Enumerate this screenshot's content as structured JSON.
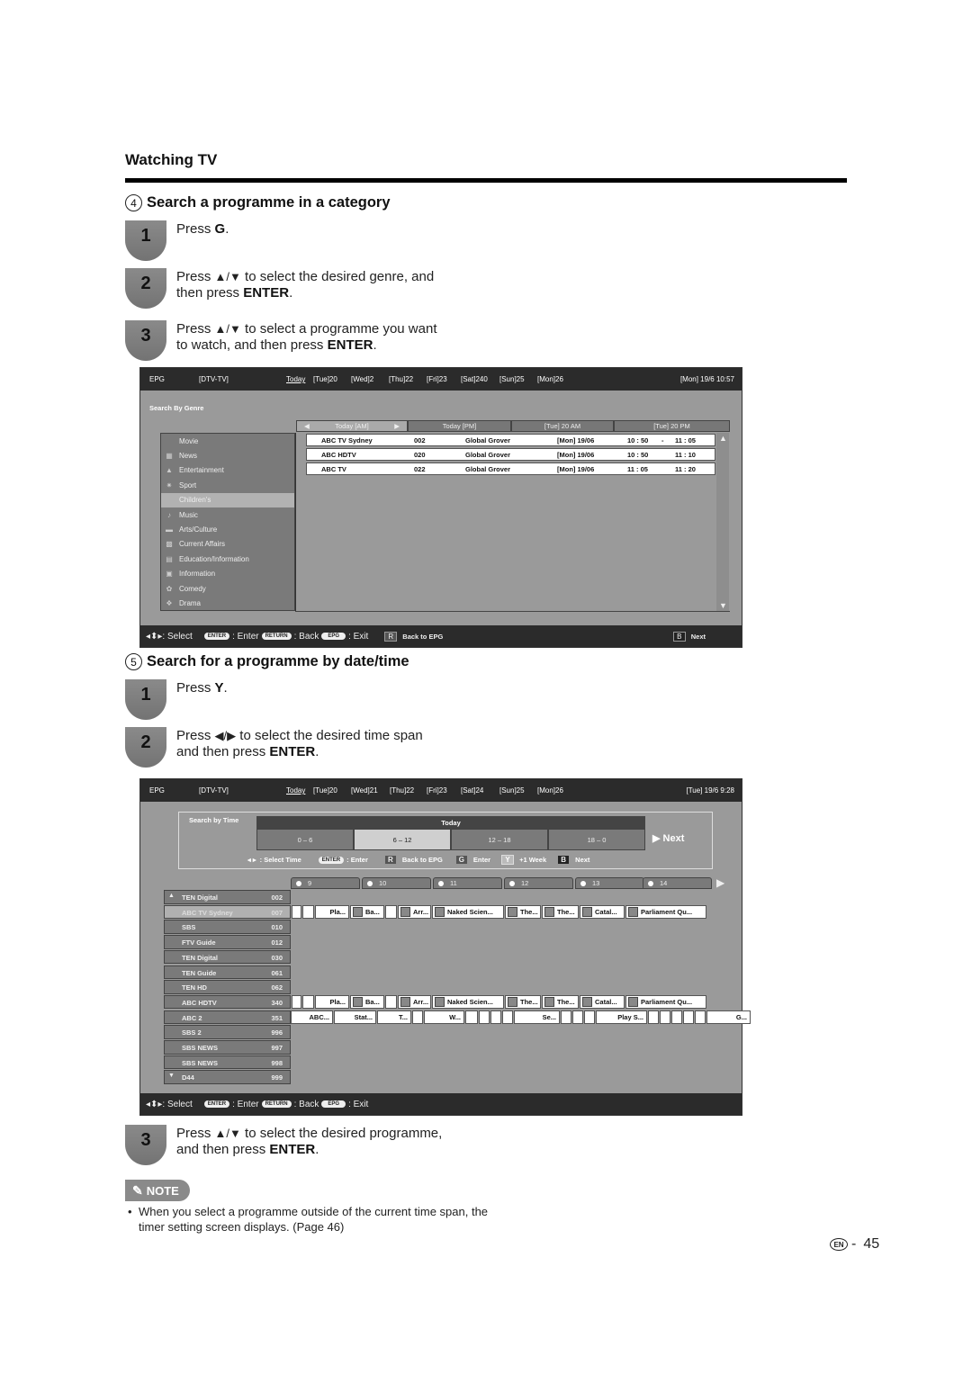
{
  "page": {
    "section_title": "Watching TV",
    "page_lang": "EN",
    "page_number": "45"
  },
  "section4": {
    "num": "4",
    "title": "Search a programme in a category",
    "steps": [
      {
        "n": "1",
        "pre": "Press ",
        "key": "G",
        "post": "."
      },
      {
        "n": "2",
        "line1": "to select the desired genre, and",
        "line2_pre": "then press ",
        "key": "ENTER",
        "post": "."
      },
      {
        "n": "3",
        "line1": "to select a programme you want",
        "line2_pre": "to watch, and then press ",
        "key": "ENTER",
        "post": "."
      }
    ]
  },
  "epg1": {
    "topbar": {
      "label": "EPG",
      "source": "[DTV-TV]",
      "days": [
        "Today",
        "[Tue]20",
        "[Wed]2",
        "[Thu]22",
        "[Fri]23",
        "[Sat]240",
        "[Sun]25",
        "[Mon]26"
      ],
      "clock": "[Mon] 19/6 10:57"
    },
    "panel_title": "Search By Genre",
    "tabs": [
      "Today [AM]",
      "Today [PM]",
      "[Tue] 20 AM",
      "[Tue] 20 PM"
    ],
    "genres": [
      {
        "label": "Movie",
        "icon": "none"
      },
      {
        "label": "News",
        "icon": "news-icon"
      },
      {
        "label": "Entertainment",
        "icon": "entertainment-icon"
      },
      {
        "label": "Sport",
        "icon": "sport-icon"
      },
      {
        "label": "Children's",
        "icon": "none",
        "selected": true
      },
      {
        "label": "Music",
        "icon": "music-icon"
      },
      {
        "label": "Arts/Culture",
        "icon": "arts-icon"
      },
      {
        "label": "Current Affairs",
        "icon": "current-affairs-icon"
      },
      {
        "label": "Education/Information",
        "icon": "education-icon"
      },
      {
        "label": "Information",
        "icon": "information-icon"
      },
      {
        "label": "Comedy",
        "icon": "comedy-icon"
      },
      {
        "label": "Drama",
        "icon": "drama-icon"
      }
    ],
    "programmes": [
      {
        "channel": "ABC TV Sydney",
        "num": "002",
        "title": "Global Grover",
        "date": "[Mon] 19/06",
        "start": "10 : 50",
        "sep": "-",
        "end": "11 : 05"
      },
      {
        "channel": "ABC HDTV",
        "num": "020",
        "title": "Global Grover",
        "date": "[Mon] 19/06",
        "start": "10 : 50",
        "sep": "",
        "end": "11 : 10"
      },
      {
        "channel": "ABC TV",
        "num": "022",
        "title": "Global Grover",
        "date": "[Mon] 19/06",
        "start": "11 : 05",
        "sep": "",
        "end": "11 : 20"
      }
    ],
    "footer": {
      "select": ": Select",
      "enter_key": "ENTER",
      "enter": ": Enter",
      "return_key": "RETURN",
      "back": ": Back",
      "epg_key": "EPG",
      "exit": ": Exit",
      "r_key": "R",
      "r_label": "Back to EPG",
      "b_key": "B",
      "b_label": "Next"
    }
  },
  "section5": {
    "num": "5",
    "title": "Search for a programme by date/time",
    "steps": [
      {
        "n": "1",
        "pre": "Press ",
        "key": "Y",
        "post": "."
      },
      {
        "n": "2",
        "line1": "to select the desired time span",
        "line2_pre": "and then press ",
        "key": "ENTER",
        "post": "."
      },
      {
        "n": "3",
        "line1": "to select the desired programme,",
        "line2_pre": "and then press ",
        "key": "ENTER",
        "post": "."
      }
    ]
  },
  "epg2": {
    "topbar": {
      "label": "EPG",
      "source": "[DTV-TV]",
      "days": [
        "Today",
        "[Tue]20",
        "[Wed]21",
        "[Thu]22",
        "[Fri]23",
        "[Sat]24",
        "[Sun]25",
        "[Mon]26"
      ],
      "clock": "[Tue] 19/6 9:28"
    },
    "time_box": {
      "title": "Search by Time",
      "day": "Today",
      "slots": [
        "0 – 6",
        "6 – 12",
        "12 – 18",
        "18 – 0"
      ],
      "selected_slot": 1,
      "next": "Next",
      "hint_select": ": Select Time",
      "enter_key": "ENTER",
      "enter": ": Enter",
      "r_key": "R",
      "r_label": "Back to EPG",
      "g_key": "G",
      "g_label": "Enter",
      "y_key": "Y",
      "y_label": "+1 Week",
      "b_key": "B",
      "b_label": "Next"
    },
    "hours": [
      "9",
      "10",
      "11",
      "12",
      "13",
      "14"
    ],
    "channels": [
      {
        "name": "TEN Digital",
        "num": "002",
        "arrow": "up"
      },
      {
        "name": "ABC TV Sydney",
        "num": "007",
        "selected": true
      },
      {
        "name": "SBS",
        "num": "010"
      },
      {
        "name": "FTV Guide",
        "num": "012"
      },
      {
        "name": "TEN Digital",
        "num": "030"
      },
      {
        "name": "TEN Guide",
        "num": "061"
      },
      {
        "name": "TEN HD",
        "num": "062"
      },
      {
        "name": "ABC HDTV",
        "num": "340"
      },
      {
        "name": "ABC 2",
        "num": "351"
      },
      {
        "name": "SBS 2",
        "num": "996"
      },
      {
        "name": "SBS NEWS",
        "num": "997"
      },
      {
        "name": "SBS NEWS",
        "num": "998"
      },
      {
        "name": "D44",
        "num": "999",
        "arrow": "down"
      }
    ],
    "row_abc": [
      "",
      "",
      "Pla...",
      "Ba...",
      "",
      "Arr...",
      "Naked Scien...",
      "The...",
      "The...",
      "Catal...",
      "Parliament Qu..."
    ],
    "row_abc2": [
      "ABC...",
      "Stat...",
      "T...",
      "",
      "W...",
      "",
      "",
      "",
      "",
      "Se...",
      "",
      "",
      "",
      "Play S...",
      "",
      "",
      "",
      "",
      "",
      "G..."
    ],
    "footer": {
      "select": ": Select",
      "enter_key": "ENTER",
      "enter": ": Enter",
      "return_key": "RETURN",
      "back": ": Back",
      "epg_key": "EPG",
      "exit": ": Exit"
    }
  },
  "note": {
    "label": "NOTE",
    "items": [
      "When you select a programme outside of the current time span, the timer setting screen displays. (Page 46)"
    ]
  }
}
